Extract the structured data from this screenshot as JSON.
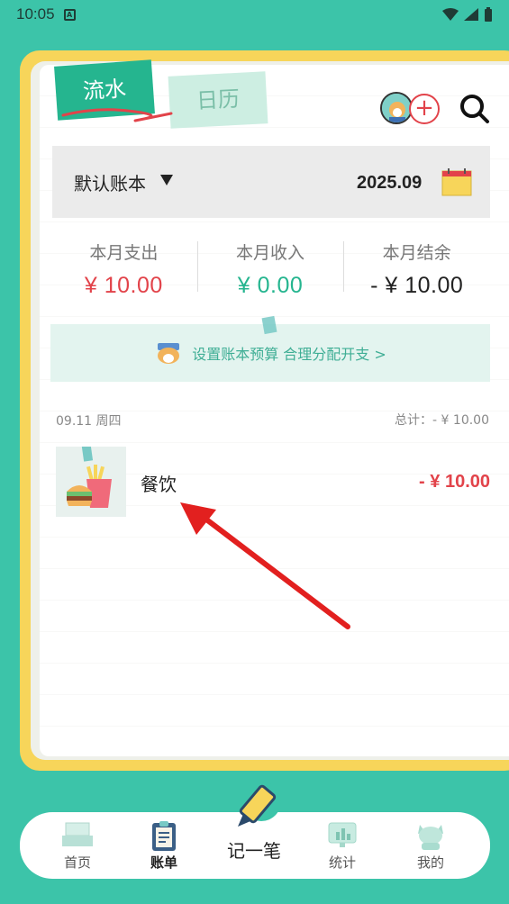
{
  "status_bar": {
    "time": "10:05",
    "notification_icon": "a-icon"
  },
  "tabs": {
    "flow": "流水",
    "calendar": "日历"
  },
  "ledger": {
    "name": "默认账本",
    "month": "2025.09"
  },
  "summary": {
    "expense_label": "本月支出",
    "expense_value": "¥ 10.00",
    "income_label": "本月收入",
    "income_value": "¥ 0.00",
    "balance_label": "本月结余",
    "balance_value": "- ¥ 10.00"
  },
  "budget_banner": {
    "text": "设置账本预算 合理分配开支 >"
  },
  "day_group": {
    "date": "09.11 周四",
    "total": "总计：- ¥ 10.00"
  },
  "records": [
    {
      "category": "餐饮",
      "amount": "- ¥ 10.00"
    }
  ],
  "nav": {
    "home": "首页",
    "bills": "账单",
    "record": "记一笔",
    "stats": "统计",
    "mine": "我的"
  },
  "colors": {
    "accent_green": "#25b58f",
    "expense_red": "#e2434a",
    "frame_yellow": "#f7d55a",
    "background": "#3cc4a9"
  }
}
